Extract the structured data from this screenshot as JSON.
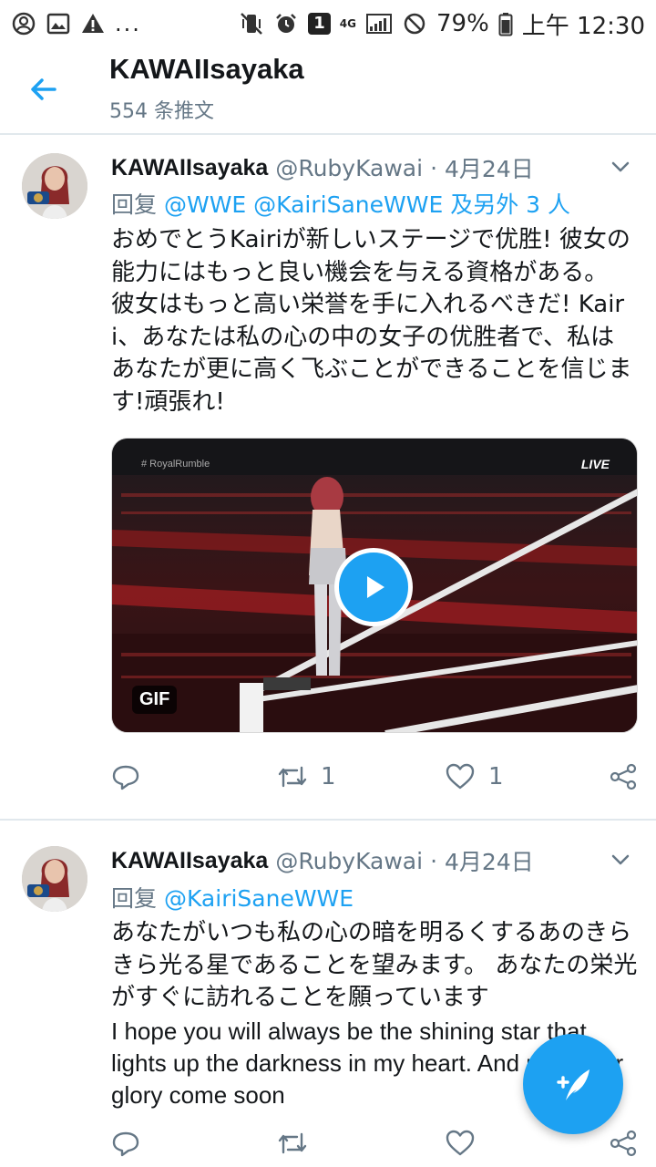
{
  "status_bar": {
    "dots": "...",
    "sim_badge": "1",
    "network": "4G",
    "battery": "79%",
    "time": "上午 12:30"
  },
  "header": {
    "title": "KAWAIIsayaka",
    "subtitle": "554 条推文"
  },
  "tweets": [
    {
      "name": "KAWAIIsayaka",
      "handle": "@RubyKawai",
      "dot": "·",
      "date": "4月24日",
      "reply_prefix": "回复",
      "reply_mentions": "@WWE @KairiSaneWWE",
      "reply_suffix": "及另外 3 人",
      "body": "おめでとうKairiが新しいステージで优胜! 彼女の能力にはもっと良い機会を与える資格がある。 彼女はもっと高い栄誉を手に入れるべきだ! Kairi、あなたは私の心の中の女子の优胜者で、私はあなたが更に高く飞ぶことができることを信じます!頑張れ!",
      "media": {
        "tag": "# RoyalRumble",
        "live": "LIVE",
        "badge": "GIF"
      },
      "retweets": "1",
      "likes": "1"
    },
    {
      "name": "KAWAIIsayaka",
      "handle": "@RubyKawai",
      "dot": "·",
      "date": "4月24日",
      "reply_prefix": "回复",
      "reply_mentions": "@KairiSaneWWE",
      "body_jp": "あなたがいつも私の心の暗を明るくするあのきらきら光る星であることを望みます。 あなたの栄光がすぐに訪れることを願っています",
      "body_en": "I hope you will always be the shining star that lights up the darkness in my heart. And may your glory come soon"
    }
  ],
  "colors": {
    "accent": "#1da1f2",
    "secondary_text": "#657786",
    "divider": "#e1e8ed"
  }
}
